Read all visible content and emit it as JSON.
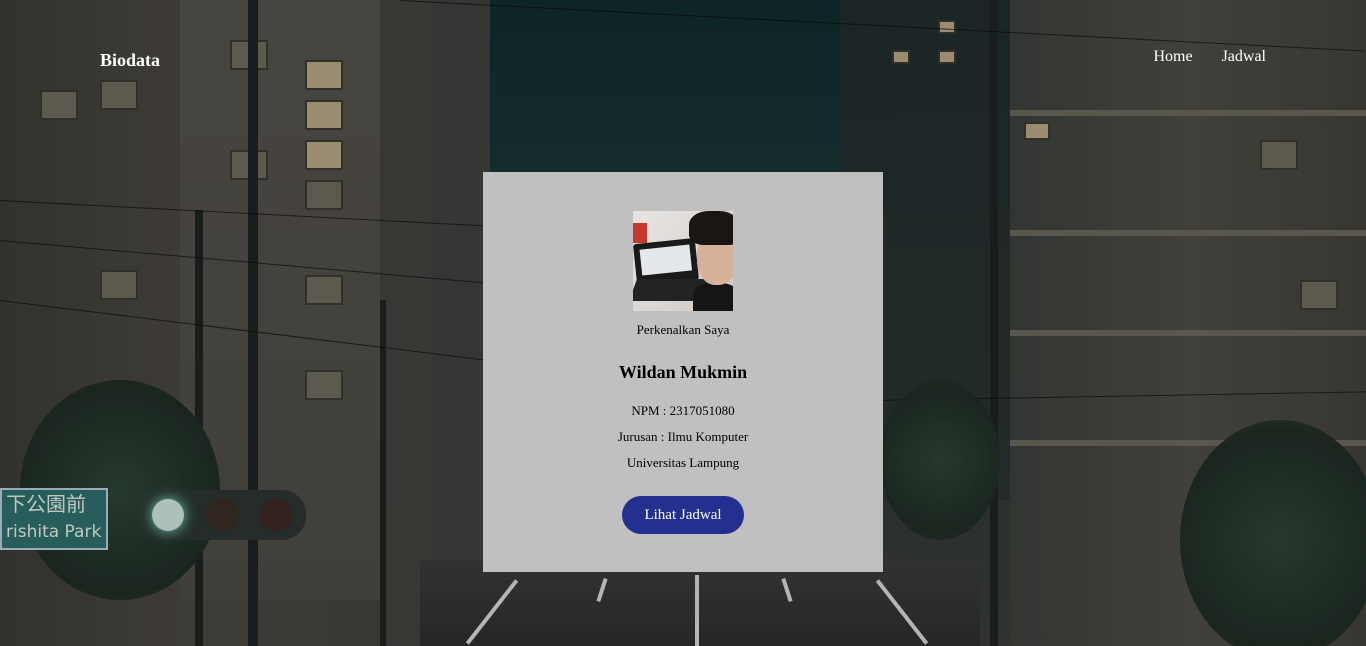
{
  "navbar": {
    "brand": "Biodata",
    "links": [
      "Home",
      "Jadwal"
    ]
  },
  "background": {
    "sign_text_line1": "下公園前",
    "sign_text_line2": "rishita Park"
  },
  "profile": {
    "intro": "Perkenalkan Saya",
    "name": "Wildan Mukmin",
    "npm": "NPM : 2317051080",
    "jurusan": "Jurusan : Ilmu Komputer",
    "universitas": "Universitas Lampung",
    "button_label": "Lihat Jadwal"
  },
  "colors": {
    "card_bg": "#c0c0c0",
    "button_bg": "#23308f",
    "nav_text": "#ffffff"
  }
}
